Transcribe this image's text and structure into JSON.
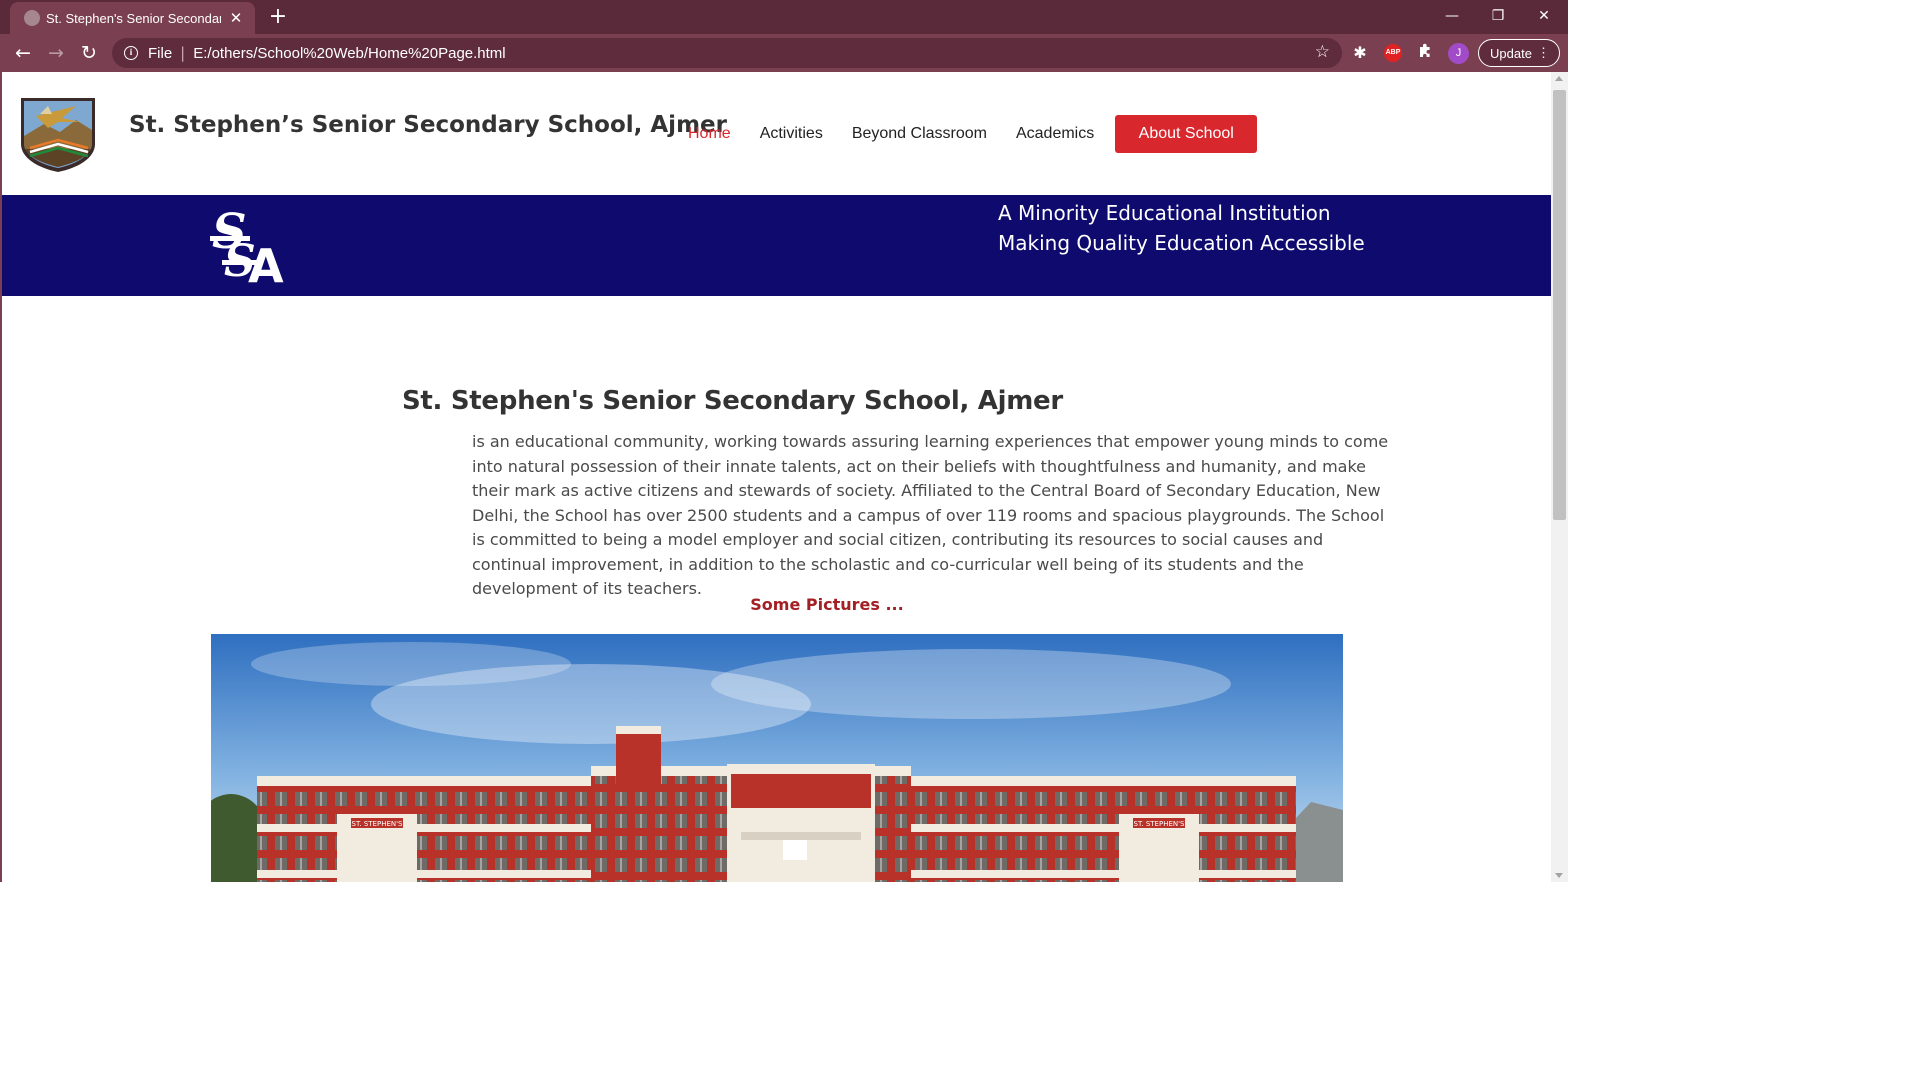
{
  "browser": {
    "tab_title": "St. Stephen's Senior Secondary S",
    "new_tab_label": "+",
    "address_scheme": "File",
    "address_url": "E:/others/School%20Web/Home%20Page.html",
    "profile_initial": "J",
    "update_label": "Update",
    "abp_label": "ABP",
    "theme_color": "#7a3f50"
  },
  "header": {
    "site_title": "St. Stephen’s Senior Secondary School, Ajmer",
    "nav": {
      "home": "Home",
      "activities": "Activities",
      "beyond": "Beyond Classroom",
      "academics": "Academics",
      "about": "About School"
    },
    "accent_color": "#d9272e"
  },
  "banner": {
    "line1": "A Minority Educational Institution",
    "line2": "Making Quality Education Accessible",
    "logo_letters": "SSA",
    "background": "#0f0a6e"
  },
  "intro": {
    "heading": "St. Stephen's Senior Secondary School, Ajmer",
    "paragraph": "is an educational community, working towards assuring learning experiences that empower young minds to come into natural possession of their innate talents, act on their beliefs with thoughtfulness and humanity, and make their mark as active citizens and stewards of society. Affiliated to the Central Board of Secondary Education, New Delhi, the School has over 2500 students and a campus of over 119 rooms and spacious playgrounds. The School is committed to being a model employer and social citizen, contributing its resources to social causes and continual improvement, in addition to the scholastic and co-curricular well being of its students and the development of its teachers."
  },
  "gallery": {
    "label": "Some Pictures ...",
    "sign_text": "ST. STEPHEN'S"
  }
}
